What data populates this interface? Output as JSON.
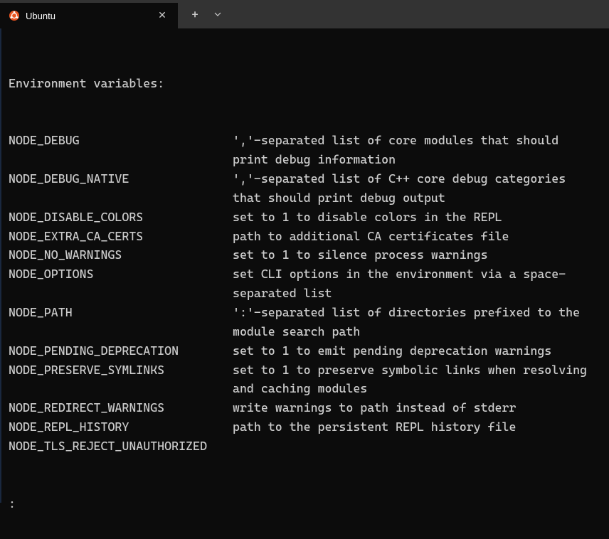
{
  "titlebar": {
    "tab_title": "Ubuntu"
  },
  "terminal": {
    "section_header": "Environment variables:",
    "entries": [
      {
        "name": "NODE_DEBUG",
        "desc": "','-separated list of core modules that should print debug information"
      },
      {
        "name": "NODE_DEBUG_NATIVE",
        "desc": "','-separated list of C++ core debug categories that should print debug output"
      },
      {
        "name": "NODE_DISABLE_COLORS",
        "desc": "set to 1 to disable colors in the REPL"
      },
      {
        "name": "NODE_EXTRA_CA_CERTS",
        "desc": "path to additional CA certificates file"
      },
      {
        "name": "NODE_NO_WARNINGS",
        "desc": "set to 1 to silence process warnings"
      },
      {
        "name": "NODE_OPTIONS",
        "desc": "set CLI options in the environment via a space-separated list"
      },
      {
        "name": "NODE_PATH",
        "desc": "':'-separated list of directories prefixed to the module search path"
      },
      {
        "name": "NODE_PENDING_DEPRECATION",
        "desc": "set to 1 to emit pending deprecation warnings"
      },
      {
        "name": "NODE_PRESERVE_SYMLINKS",
        "desc": "set to 1 to preserve symbolic links when resolving and caching modules"
      },
      {
        "name": "NODE_REDIRECT_WARNINGS",
        "desc": "write warnings to path instead of stderr"
      },
      {
        "name": "NODE_REPL_HISTORY",
        "desc": "path to the persistent REPL history file"
      },
      {
        "name": "NODE_TLS_REJECT_UNAUTHORIZED",
        "desc": ""
      }
    ],
    "prompt": ":"
  }
}
